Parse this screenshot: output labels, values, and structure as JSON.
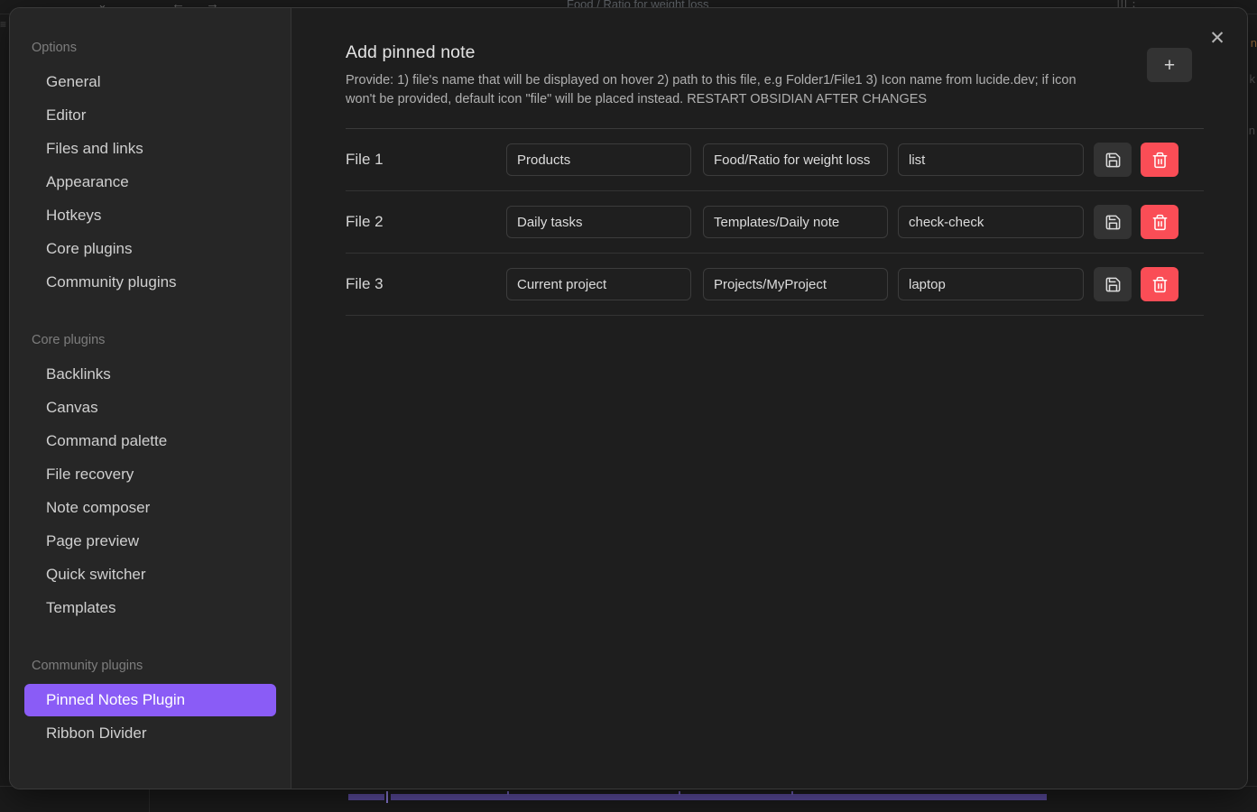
{
  "background": {
    "breadcrumb": "Food / Ratio for weight loss",
    "nav_back_icon": "arrow-left-icon",
    "nav_forward_icon": "arrow-right-icon",
    "chevron_icon": "chevron-down-icon",
    "hamburger_icon": "menu-icon",
    "sidebar_toggle_icon": "sidebar-toggle-icon",
    "more_icon": "more-options-icon",
    "right_text_1": "n",
    "right_text_2": "k",
    "right_text_3": "n",
    "nav_back_glyph": "←",
    "nav_forward_glyph": "→",
    "chevron_glyph": "⌄",
    "hamburger_glyph": "≡",
    "sidebar_toggle_glyph": "|||",
    "more_glyph": "⋮"
  },
  "modal": {
    "close_label": "✕",
    "close_icon": "close-icon"
  },
  "sidebar": {
    "groups": [
      {
        "title": "Options",
        "items": [
          {
            "label": "General",
            "active": false
          },
          {
            "label": "Editor",
            "active": false
          },
          {
            "label": "Files and links",
            "active": false
          },
          {
            "label": "Appearance",
            "active": false
          },
          {
            "label": "Hotkeys",
            "active": false
          },
          {
            "label": "Core plugins",
            "active": false
          },
          {
            "label": "Community plugins",
            "active": false
          }
        ]
      },
      {
        "title": "Core plugins",
        "items": [
          {
            "label": "Backlinks",
            "active": false
          },
          {
            "label": "Canvas",
            "active": false
          },
          {
            "label": "Command palette",
            "active": false
          },
          {
            "label": "File recovery",
            "active": false
          },
          {
            "label": "Note composer",
            "active": false
          },
          {
            "label": "Page preview",
            "active": false
          },
          {
            "label": "Quick switcher",
            "active": false
          },
          {
            "label": "Templates",
            "active": false
          }
        ]
      },
      {
        "title": "Community plugins",
        "items": [
          {
            "label": "Pinned Notes Plugin",
            "active": true
          },
          {
            "label": "Ribbon Divider",
            "active": false
          }
        ]
      }
    ]
  },
  "main": {
    "header": {
      "title": "Add pinned note",
      "description": "Provide: 1) file's name that will be displayed on hover 2) path to this file, e.g Folder1/File1 3) Icon name from lucide.dev; if icon won't be provided, default icon \"file\" will be placed instead. RESTART OBSIDIAN AFTER CHANGES",
      "add_button_label": "+",
      "add_button_icon": "plus-icon"
    },
    "rows": [
      {
        "label": "File 1",
        "name_value": "Products",
        "path_value": "Food/Ratio for weight loss",
        "icon_value": "list",
        "save_icon": "save-floppy-icon",
        "delete_icon": "trash-icon"
      },
      {
        "label": "File 2",
        "name_value": "Daily tasks",
        "path_value": "Templates/Daily note",
        "icon_value": "check-check",
        "save_icon": "save-floppy-icon",
        "delete_icon": "trash-icon"
      },
      {
        "label": "File 3",
        "name_value": "Current project",
        "path_value": "Projects/MyProject",
        "icon_value": "laptop",
        "save_icon": "save-floppy-icon",
        "delete_icon": "trash-icon"
      }
    ]
  },
  "colors": {
    "accent": "#8a5cf6",
    "danger": "#fa4d56",
    "modal_bg": "#1e1e1e",
    "sidebar_bg": "#262626",
    "input_bg": "#1f1f1f",
    "button_bg": "#333333"
  }
}
